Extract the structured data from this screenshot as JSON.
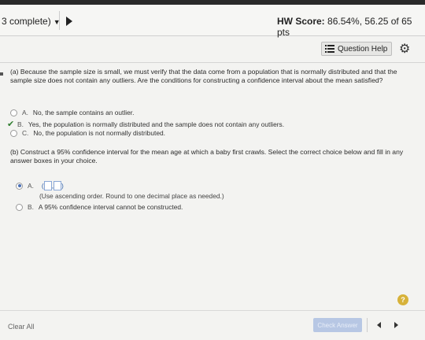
{
  "header": {
    "progress": "3 complete)",
    "score_label": "HW Score:",
    "score_value": "86.54%, 56.25 of 65 pts"
  },
  "toolbar": {
    "help_label": "Question Help",
    "help_icon": "list-icon",
    "settings_icon": "gear-icon"
  },
  "part_a": {
    "prompt": "(a) Because the sample size is small, we must verify that the data come from a population that is normally distributed and that the sample size does not contain any outliers. Are the conditions for constructing a confidence interval about the mean satisfied?",
    "options": [
      {
        "letter": "A.",
        "text": "No, the sample contains an outlier."
      },
      {
        "letter": "B.",
        "text": "Yes, the population is normally distributed and the sample does not contain any outliers."
      },
      {
        "letter": "C.",
        "text": "No, the population is not normally distributed."
      }
    ]
  },
  "part_b": {
    "prompt": "(b) Construct a 95% confidence interval for the mean age at which a baby first crawls. Select the correct choice below and fill in any answer boxes in your choice.",
    "option_a_letter": "A.",
    "hint": "(Use ascending order. Round to one decimal place as needed.)",
    "option_b_letter": "B.",
    "option_b_text": "A 95% confidence interval cannot be constructed."
  },
  "footer": {
    "clear_all": "Clear All",
    "check_answer": "Check Answer",
    "help_symbol": "?"
  },
  "colors": {
    "accent": "#2a5ca8",
    "correct": "#2f7d2f",
    "help": "#d7b23a"
  }
}
